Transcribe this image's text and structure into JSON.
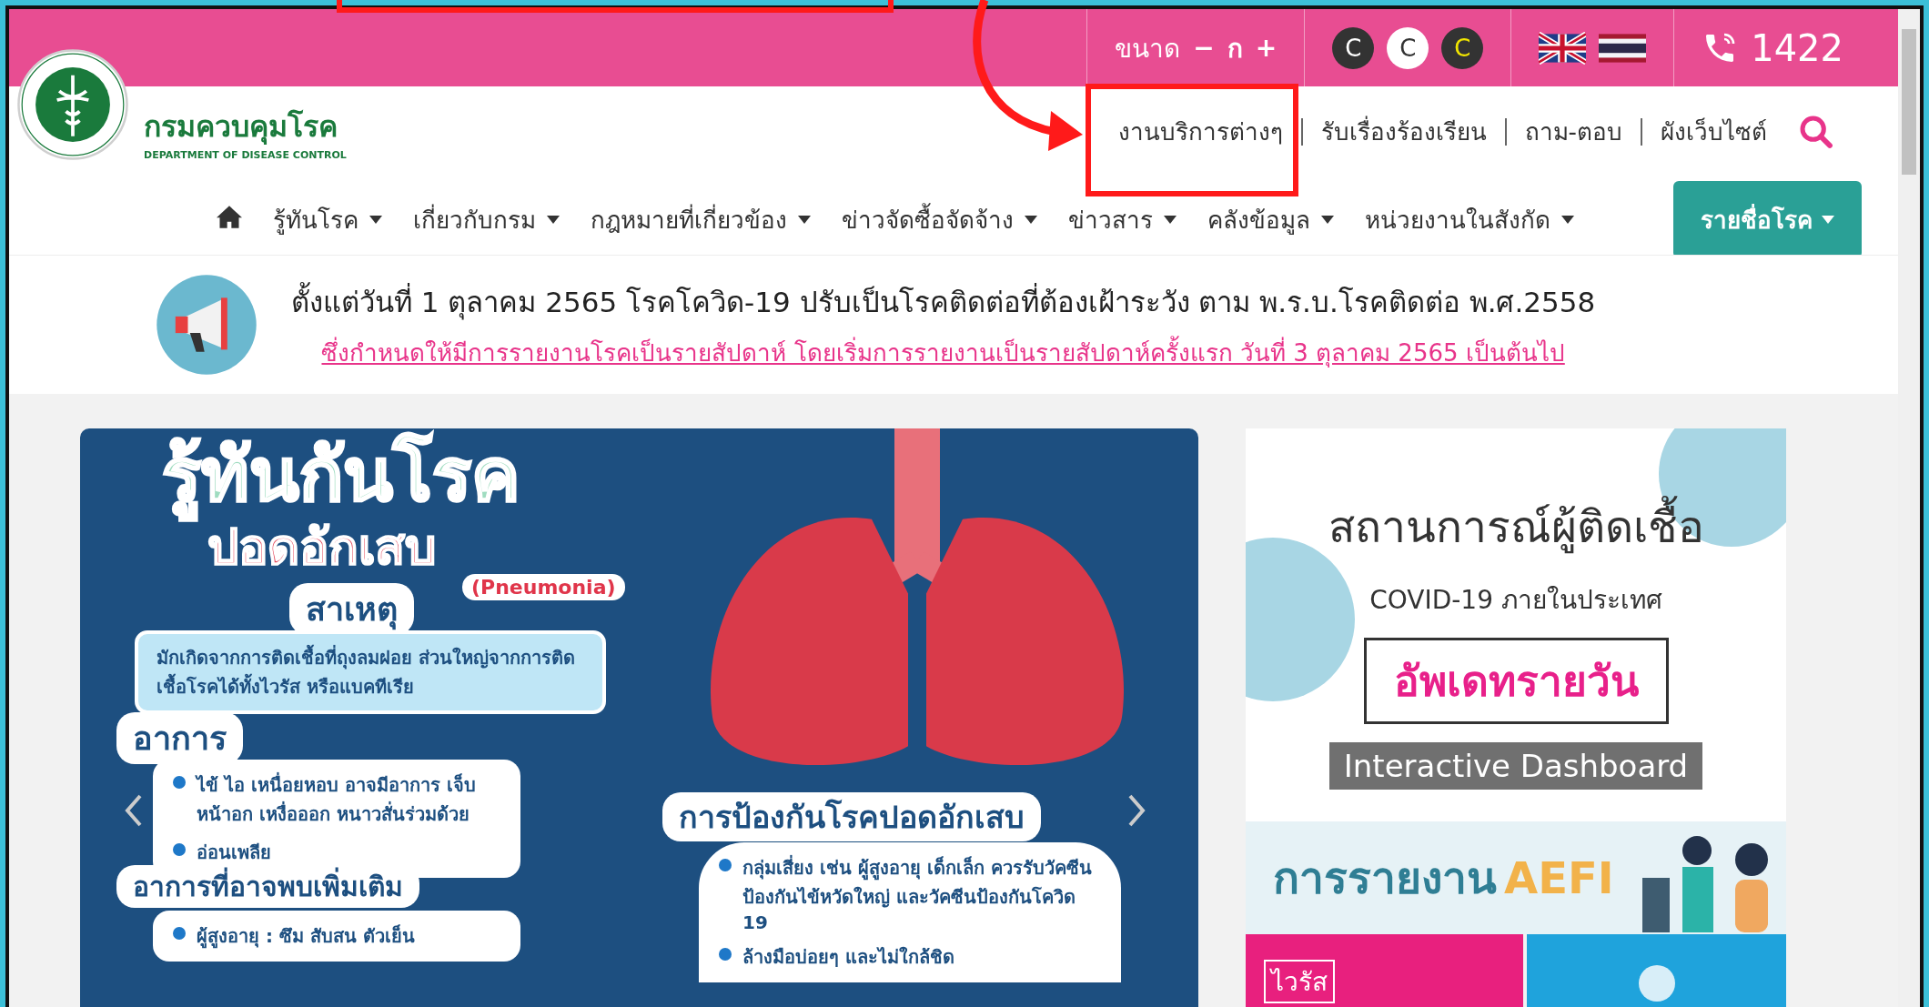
{
  "top_bar": {
    "size_label": "ขนาด",
    "size_controls": [
      "−",
      "ก",
      "+"
    ],
    "contrast_buttons": [
      {
        "label": "C",
        "kind": "dark"
      },
      {
        "label": "C",
        "kind": "light"
      },
      {
        "label": "C",
        "kind": "yellow"
      }
    ],
    "hotline": "1422"
  },
  "header": {
    "logo_title": "กรมควบคุมโรค",
    "logo_subtitle": "DEPARTMENT OF DISEASE CONTROL",
    "links": [
      "งานบริการต่างๆ",
      "รับเรื่องร้องเรียน",
      "ถาม-ตอบ",
      "ผังเว็บไซต์"
    ]
  },
  "nav": {
    "items": [
      "รู้ทันโรค",
      "เกี่ยวกับกรม",
      "กฎหมายที่เกี่ยวข้อง",
      "ข่าวจัดซื้อจัดจ้าง",
      "ข่าวสาร",
      "คลังข้อมูล",
      "หน่วยงานในสังกัด"
    ],
    "highlight_button": "รายชื่อโรค"
  },
  "announcement": {
    "line1": "ตั้งแต่วันที่ 1 ตุลาคม 2565 โรคโควิด-19 ปรับเป็นโรคติดต่อที่ต้องเฝ้าระวัง ตาม พ.ร.บ.โรคติดต่อ พ.ศ.2558",
    "line2": "ซึ่งกำหนดให้มีการรายงานโรคเป็นรายสัปดาห์ โดยเริ่มการรายงานเป็นรายสัปดาห์ครั้งแรก วันที่ 3 ตุลาคม 2565 เป็นต้นไป"
  },
  "poster": {
    "title": "รู้ทันกันโรค",
    "subtitle": "ปอดอักเสบ",
    "english": "(Pneumonia)",
    "cause_heading": "สาเหตุ",
    "cause_text": "มักเกิดจากการติดเชื้อที่ถุงลมฝอย ส่วนใหญ่จากการติดเชื้อโรคได้ทั้งไวรัส หรือแบคทีเรีย",
    "symptoms_heading": "อาการ",
    "symptoms": [
      "ไข้ ไอ เหนื่อยหอบ อาจมีอาการ เจ็บหน้าอก เหงื่อออก หนาวสั่นร่วมด้วย",
      "อ่อนเพลีย"
    ],
    "more_heading": "อาการที่อาจพบเพิ่มเติม",
    "more": [
      "ผู้สูงอายุ : ซึม สับสน ตัวเย็น"
    ],
    "prevention_heading": "การป้องกันโรคปอดอักเสบ",
    "prevention": [
      "กลุ่มเสี่ยง เช่น ผู้สูงอายุ เด็กเล็ก ควรรับวัคซีนป้องกันไข้หวัดใหญ่ และวัคซีนป้องกันโควิด 19",
      "ล้างมือบ่อยๆ และไม่ใกล้ชิด"
    ]
  },
  "side_banners": {
    "situation": {
      "title": "สถานการณ์ผู้ติดเชื้อ",
      "subtitle": "COVID-19 ภายในประเทศ",
      "update": "อัพเดทรายวัน",
      "dashboard": "Interactive Dashboard"
    },
    "aefi": {
      "text": "การรายงาน",
      "highlight": "AEFI"
    },
    "tile": "ไวรัส"
  }
}
